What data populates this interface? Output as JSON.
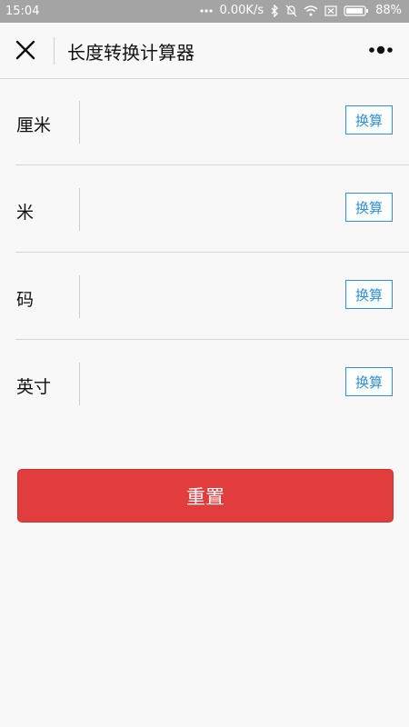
{
  "status_bar": {
    "time": "15:04",
    "network_speed": "0.00K/s",
    "battery": "88%"
  },
  "nav": {
    "title": "长度转换计算器",
    "icons": [
      "close-icon",
      "more-icon"
    ]
  },
  "rows": [
    {
      "label": "厘米",
      "value": "",
      "button_label": "换算"
    },
    {
      "label": "米",
      "value": "",
      "button_label": "换算"
    },
    {
      "label": "码",
      "value": "",
      "button_label": "换算"
    },
    {
      "label": "英寸",
      "value": "",
      "button_label": "换算"
    }
  ],
  "reset_label": "重置",
  "colors": {
    "accent_blue": "#2f8fd8",
    "reset_red": "#e13d3c",
    "status_bar": "#a4a4a4"
  }
}
